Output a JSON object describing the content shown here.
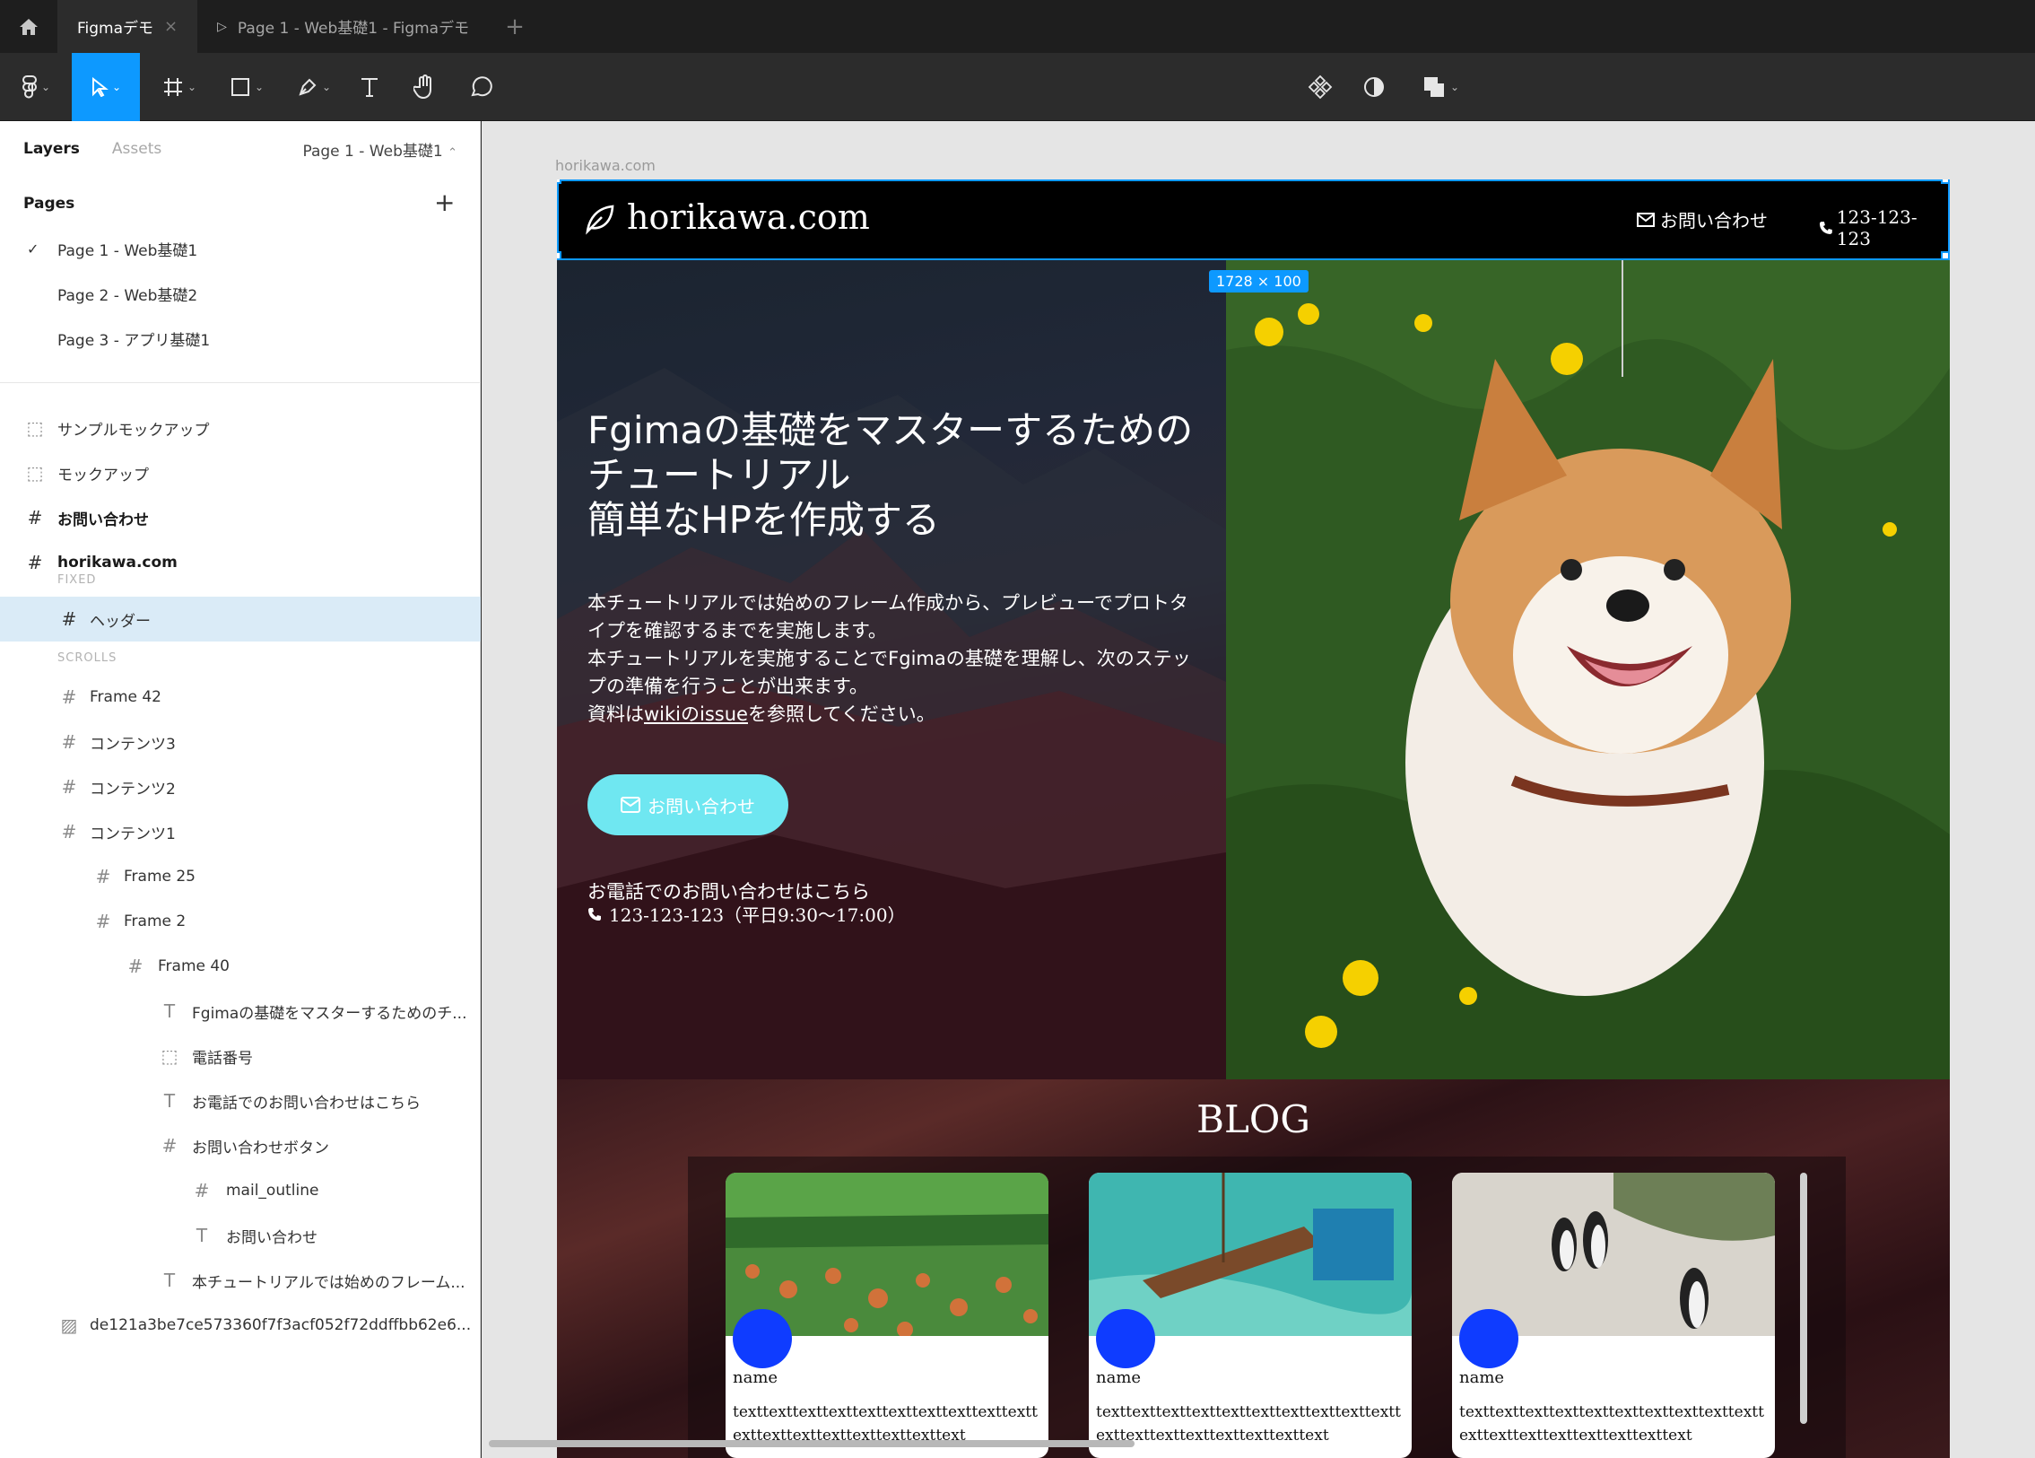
{
  "titlebar": {
    "home_icon": "home-icon",
    "tabs": [
      {
        "label": "Figmaデモ",
        "active": true
      },
      {
        "label": "Page 1 - Web基礎1 - Figmaデモ",
        "active": false
      }
    ],
    "add_tab": "+"
  },
  "toolbar": {
    "tools": [
      "figma-menu-icon",
      "move-tool-icon",
      "frame-tool-icon",
      "shape-tool-icon",
      "pen-tool-icon",
      "text-tool-icon",
      "hand-tool-icon",
      "comment-tool-icon"
    ],
    "right_tools": [
      "components-icon",
      "mask-icon",
      "boolean-icon"
    ],
    "active_tool": "move"
  },
  "left_panel": {
    "tab_layers": "Layers",
    "tab_assets": "Assets",
    "page_selector": "Page 1 - Web基礎1",
    "pages_title": "Pages",
    "pages": [
      {
        "label": "Page 1 - Web基礎1",
        "checked": true
      },
      {
        "label": "Page 2 - Web基礎2",
        "checked": false
      },
      {
        "label": "Page 3 - アプリ基礎1",
        "checked": false
      }
    ],
    "layers": [
      {
        "label": "サンプルモックアップ",
        "icon": "section-icon"
      },
      {
        "label": "モックアップ",
        "icon": "section-icon"
      },
      {
        "label": "お問い合わせ",
        "icon": "frame-icon"
      },
      {
        "label": "horikawa.com",
        "icon": "frame-icon"
      },
      {
        "label": "FIXED",
        "icon": "label"
      },
      {
        "label": "ヘッダー",
        "icon": "frame-icon"
      },
      {
        "label": "SCROLLS",
        "icon": "label"
      },
      {
        "label": "Frame 42",
        "icon": "frame-icon"
      },
      {
        "label": "コンテンツ3",
        "icon": "frame-icon"
      },
      {
        "label": "コンテンツ2",
        "icon": "frame-icon"
      },
      {
        "label": "コンテンツ1",
        "icon": "frame-icon"
      },
      {
        "label": "Frame 25",
        "icon": "frame-icon"
      },
      {
        "label": "Frame 2",
        "icon": "frame-icon"
      },
      {
        "label": "Frame 40",
        "icon": "frame-icon"
      },
      {
        "label": "Fgimaの基礎をマスターするためのチ...",
        "icon": "text-icon"
      },
      {
        "label": "電話番号",
        "icon": "section-icon"
      },
      {
        "label": "お電話でのお問い合わせはこちら",
        "icon": "text-icon"
      },
      {
        "label": "お問い合わせボタン",
        "icon": "frame-icon"
      },
      {
        "label": "mail_outline",
        "icon": "frame-icon"
      },
      {
        "label": "お問い合わせ",
        "icon": "text-icon"
      },
      {
        "label": "本チュートリアルでは始めのフレーム...",
        "icon": "text-icon"
      },
      {
        "label": "de121a3be7ce573360f7f3acf052f72ddffbb62e6...",
        "icon": "image-icon"
      }
    ]
  },
  "canvas": {
    "frame_label": "horikawa.com",
    "size_badge": "1728 × 100",
    "site": {
      "logo": "horikawa.com",
      "nav_contact": "お問い合わせ",
      "nav_phone": "123-123-123",
      "hero_title": "Fgimaの基礎をマスターするための\nチュートリアル\n簡単なHPを作成する",
      "hero_desc_1": "本チュートリアルでは始めのフレーム作成から、プレビューでプロトタイプを確認するまでを実施します。\n本チュートリアルを実施することでFgimaの基礎を理解し、次のステップの準備を行うことが出来ます。\n資料は",
      "hero_desc_link": "wikiのissue",
      "hero_desc_2": "を参照してください。",
      "cta_label": "お問い合わせ",
      "tel_label": "お電話でのお問い合わせはこちら",
      "tel_number": "123-123-123（平日9:30〜17:00）",
      "blog_title": "BLOG",
      "cards": [
        {
          "name": "name",
          "text": "texttexttexttexttexttexttexttexttexttexttexttexttexttexttexttexttexttext"
        },
        {
          "name": "name",
          "text": "texttexttexttexttexttexttexttexttexttexttexttexttexttexttexttexttexttext"
        },
        {
          "name": "name",
          "text": "texttexttexttexttexttexttexttexttexttexttexttexttexttexttexttexttexttext"
        }
      ]
    }
  },
  "colors": {
    "accent": "#0d99ff",
    "cta": "#6fe7f1",
    "avatar": "#0f3cff",
    "selected_layer": "#daebf7"
  }
}
